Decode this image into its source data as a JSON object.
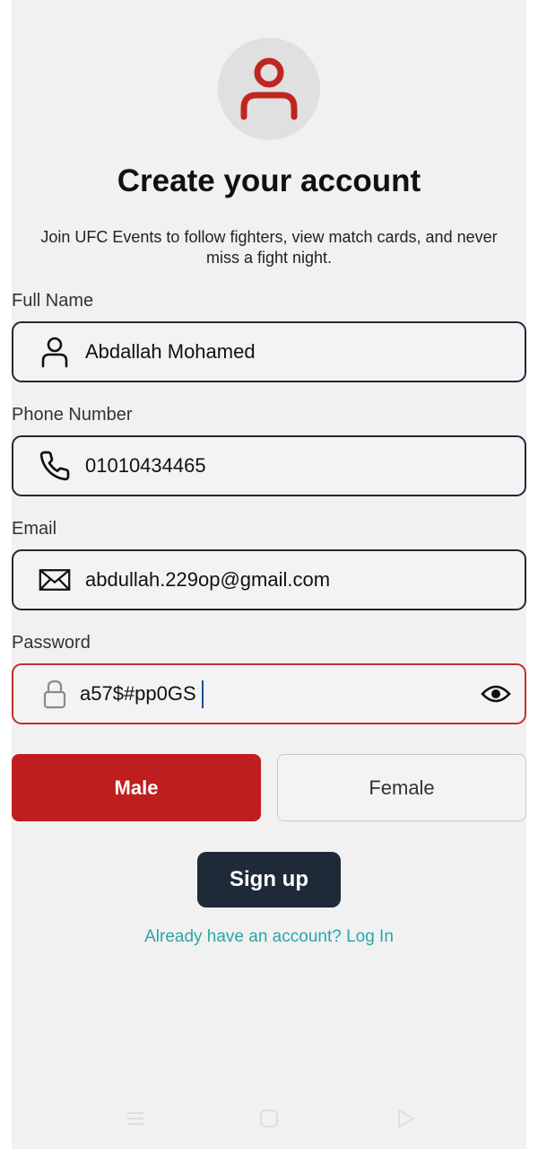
{
  "header": {
    "title": "Create your account",
    "subtitle": "Join UFC Events to follow fighters, view match cards, and never miss a fight night."
  },
  "form": {
    "full_name": {
      "label": "Full Name",
      "value": "Abdallah Mohamed",
      "icon": "user-icon"
    },
    "phone": {
      "label": "Phone Number",
      "value": "01010434465",
      "icon": "phone-icon"
    },
    "email": {
      "label": "Email",
      "value": "abdullah.229op@gmail.com",
      "icon": "mail-icon"
    },
    "password": {
      "label": "Password",
      "value": "a57$#pp0GS",
      "icon": "lock-icon",
      "toggle_icon": "eye-icon"
    }
  },
  "gender": {
    "options": [
      "Male",
      "Female"
    ],
    "selected": "Male"
  },
  "actions": {
    "signup_label": "Sign up",
    "login_link": "Already have an account? Log In"
  },
  "colors": {
    "accent_red": "#bf1e1e",
    "dark_navy": "#1f2a38",
    "link_teal": "#2aa6a6",
    "background": "#f1f1f1"
  }
}
